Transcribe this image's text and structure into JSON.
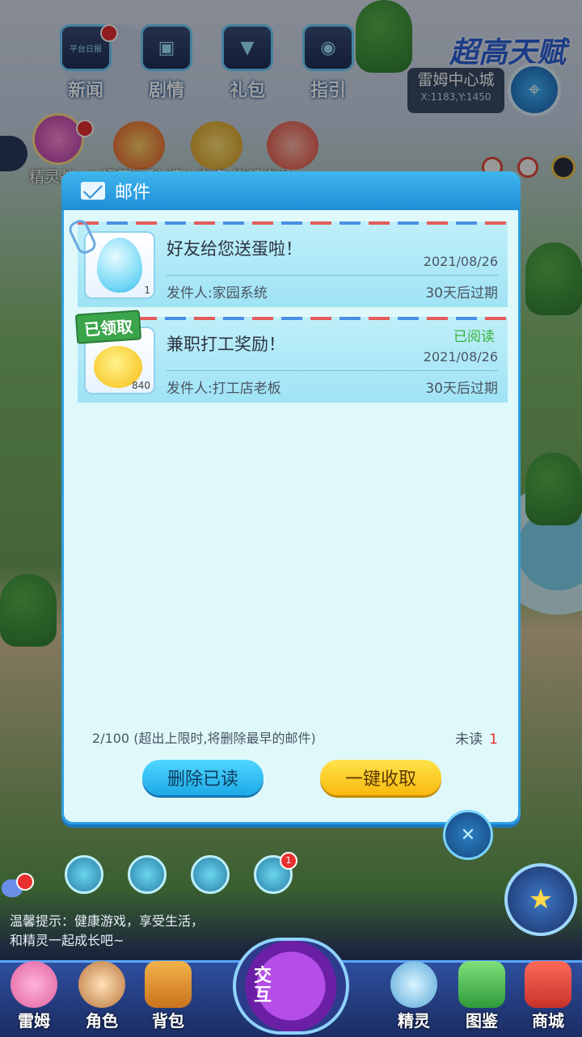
{
  "top_menu": {
    "news": "新闻",
    "story": "剧情",
    "gift": "礼包",
    "guide": "指引"
  },
  "news_icon_text": "平台日报",
  "city": {
    "name": "雷姆中心城",
    "coords": "X:1183,Y:1450"
  },
  "event_banner": "超高天赋",
  "ticker": "精灵战 ＜ 超值福利 榜上有名 邀请有礼",
  "mail": {
    "title": "邮件",
    "items": [
      {
        "subject": "好友给您送蛋啦！",
        "date": "2021/08/26",
        "sender": "发件人:家园系统",
        "expire": "30天后过期",
        "count": "1",
        "status": "",
        "badge": ""
      },
      {
        "subject": "兼职打工奖励！",
        "date": "2021/08/26",
        "sender": "发件人:打工店老板",
        "expire": "30天后过期",
        "count": "840",
        "status": "已阅读",
        "badge": "已领取"
      }
    ],
    "capacity": "2/100 (超出上限时,将删除最早的邮件)",
    "unread_label": "未读",
    "unread_count": "1",
    "delete_read": "删除已读",
    "collect_all": "一键收取"
  },
  "tips": {
    "line1": "温馨提示：健康游戏，享受生活，",
    "line2": "和精灵一起成长吧~"
  },
  "bottom_nav": {
    "leimu": "雷姆",
    "role": "角色",
    "bag": "背包",
    "interact": "交互",
    "sprite": "精灵",
    "atlas": "图鉴",
    "shop": "商城"
  },
  "bell_badge": "1",
  "colors": {
    "accent_blue": "#1f8ed6",
    "panel_bg": "#dff9fb",
    "read_green": "#37b33a",
    "unread_red": "#e83030",
    "button_yellow": "#f8b90e"
  }
}
